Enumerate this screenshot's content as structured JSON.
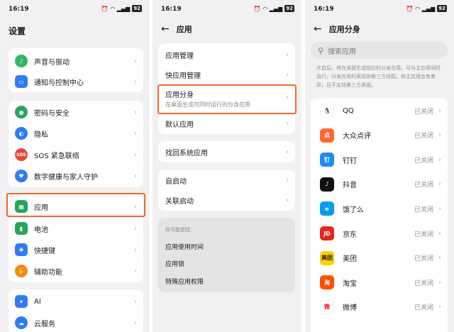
{
  "status_bar": {
    "time": "16:19",
    "icons": [
      "alarm-icon",
      "vibrate-icon",
      "hd-icon",
      "wifi-icon",
      "signal-icon"
    ],
    "battery": "92"
  },
  "panel1": {
    "title": "设置",
    "groups": [
      {
        "items": [
          {
            "label": "声音与振动",
            "icon": "bell-icon",
            "color": "#34b368",
            "glyph": "♪"
          },
          {
            "label": "通知与控制中心",
            "icon": "notification-icon",
            "color": "#2f7bf4",
            "glyph": "▭"
          }
        ]
      },
      {
        "items": [
          {
            "label": "密码与安全",
            "icon": "key-icon",
            "color": "#28a55c",
            "glyph": "●"
          },
          {
            "label": "隐私",
            "icon": "privacy-icon",
            "color": "#2f7bf4",
            "glyph": "◐"
          },
          {
            "label": "SOS 紧急联络",
            "icon": "sos-icon",
            "color": "#e5483b",
            "glyph": "SOS"
          },
          {
            "label": "数字健康与家人守护",
            "icon": "family-icon",
            "color": "#2f7bf4",
            "glyph": "♥"
          }
        ]
      },
      {
        "items": [
          {
            "label": "应用",
            "icon": "apps-icon",
            "color": "#28a55c",
            "glyph": "▦"
          },
          {
            "label": "电池",
            "icon": "battery-icon",
            "color": "#28a55c",
            "glyph": "▮"
          },
          {
            "label": "快捷键",
            "icon": "shortcut-icon",
            "color": "#2f7bf4",
            "glyph": "✚"
          },
          {
            "label": "辅助功能",
            "icon": "accessibility-icon",
            "color": "#f08a1c",
            "glyph": "✋"
          }
        ]
      },
      {
        "items": [
          {
            "label": "AI",
            "icon": "ai-icon",
            "color": "#2f7bf4",
            "glyph": "✦"
          },
          {
            "label": "云服务",
            "icon": "cloud-icon",
            "color": "#2f7bf4",
            "glyph": "☁"
          }
        ]
      }
    ]
  },
  "panel2": {
    "title": "应用",
    "group1": [
      {
        "label": "应用管理"
      },
      {
        "label": "快应用管理"
      },
      {
        "label": "应用分身",
        "sub": "在桌面生成可同时运行的分身应用"
      },
      {
        "label": "默认应用"
      }
    ],
    "group2": [
      {
        "label": "找回系统应用"
      }
    ],
    "group3": [
      {
        "label": "自启动"
      },
      {
        "label": "关联启动"
      }
    ],
    "suggest": {
      "heading": "你可能想找：",
      "items": [
        "应用使用时间",
        "应用锁",
        "特殊应用权限"
      ]
    }
  },
  "panel3": {
    "title": "应用分身",
    "search_placeholder": "搜索应用",
    "description": "开启后，将在桌面生成相应的分身应用，可与主应用同时运行。分身应用的表现依赖三方适配，和主应用会有差异，且不支持第三方桌面。",
    "apps": [
      {
        "name": "QQ",
        "status": "已关闭",
        "icon": "qq-icon",
        "color": "#ffffff",
        "glyph": "🐧",
        "text_color": "#111"
      },
      {
        "name": "大众点评",
        "status": "已关闭",
        "icon": "dianping-icon",
        "color": "#ff6633",
        "glyph": "点",
        "text_color": "#fff"
      },
      {
        "name": "钉钉",
        "status": "已关闭",
        "icon": "dingtalk-icon",
        "color": "#1f8bf7",
        "glyph": "钉",
        "text_color": "#fff"
      },
      {
        "name": "抖音",
        "status": "已关闭",
        "icon": "douyin-icon",
        "color": "#111111",
        "glyph": "♪",
        "text_color": "#fff"
      },
      {
        "name": "饿了么",
        "status": "已关闭",
        "icon": "eleme-icon",
        "color": "#0a9af0",
        "glyph": "e",
        "text_color": "#fff"
      },
      {
        "name": "京东",
        "status": "已关闭",
        "icon": "jd-icon",
        "color": "#e3261f",
        "glyph": "JD",
        "text_color": "#fff"
      },
      {
        "name": "美团",
        "status": "已关闭",
        "icon": "meituan-icon",
        "color": "#ffd100",
        "glyph": "美团",
        "text_color": "#222"
      },
      {
        "name": "淘宝",
        "status": "已关闭",
        "icon": "taobao-icon",
        "color": "#ff5000",
        "glyph": "淘",
        "text_color": "#fff"
      },
      {
        "name": "微博",
        "status": "已关闭",
        "icon": "weibo-icon",
        "color": "#ffffff",
        "glyph": "微",
        "text_color": "#e6162d"
      }
    ]
  },
  "accent": "#f06a2a"
}
